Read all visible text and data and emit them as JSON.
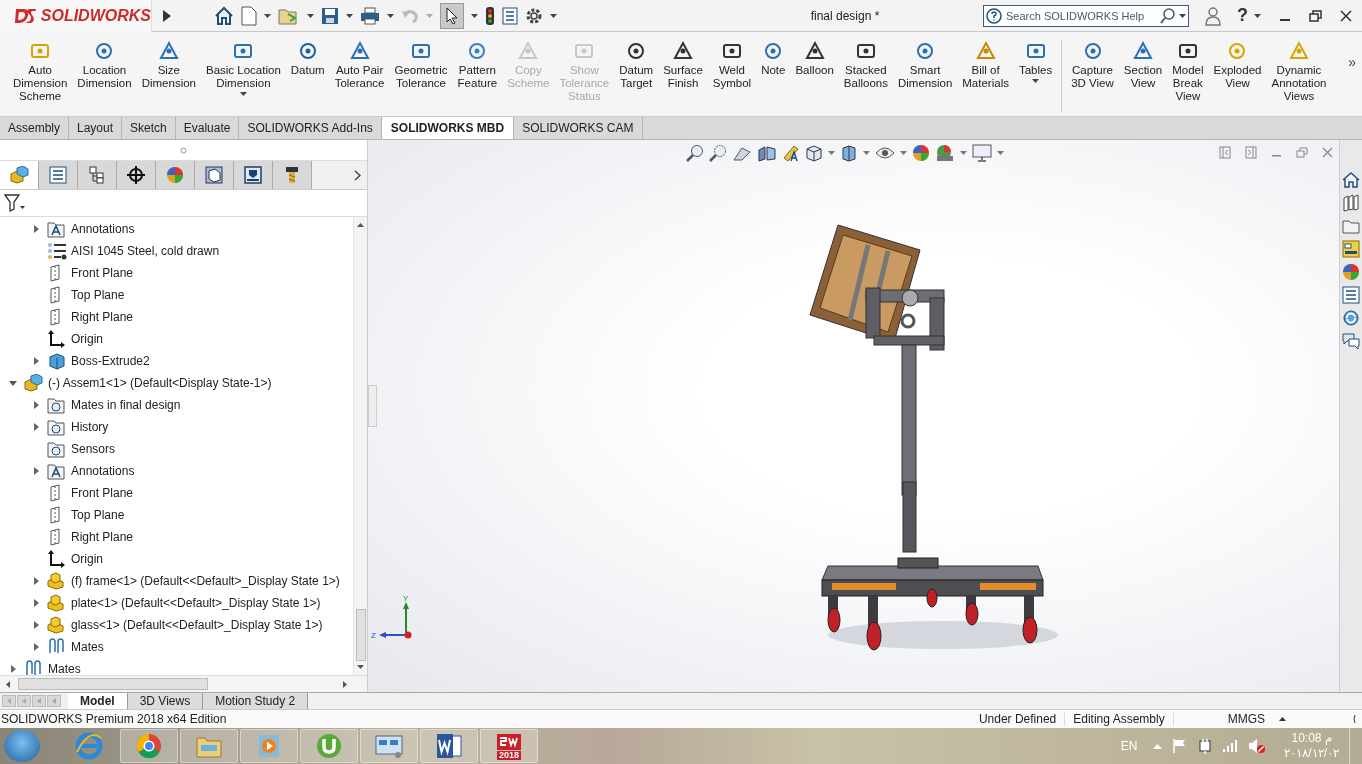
{
  "app": {
    "logo": "SOLIDWORKS",
    "title": "final design *",
    "search": {
      "placeholder": "Search SOLIDWORKS Help"
    },
    "help": "?"
  },
  "ribbon": {
    "commands": [
      {
        "label": "Auto\nDimension\nScheme",
        "disabled": false,
        "dropdown": false,
        "separator_before": false
      },
      {
        "label": "Location\nDimension",
        "disabled": false,
        "dropdown": false,
        "separator_before": false
      },
      {
        "label": "Size\nDimension",
        "disabled": false,
        "dropdown": false,
        "separator_before": false
      },
      {
        "label": "Basic Location\nDimension",
        "disabled": false,
        "dropdown": true,
        "separator_before": false
      },
      {
        "label": "Datum",
        "disabled": false,
        "dropdown": false,
        "separator_before": false
      },
      {
        "label": "Auto Pair\nTolerance",
        "disabled": false,
        "dropdown": false,
        "separator_before": false
      },
      {
        "label": "Geometric\nTolerance",
        "disabled": false,
        "dropdown": false,
        "separator_before": false
      },
      {
        "label": "Pattern\nFeature",
        "disabled": false,
        "dropdown": false,
        "separator_before": false
      },
      {
        "label": "Copy\nScheme",
        "disabled": true,
        "dropdown": false,
        "separator_before": false
      },
      {
        "label": "Show\nTolerance\nStatus",
        "disabled": true,
        "dropdown": false,
        "separator_before": false
      },
      {
        "label": "Datum\nTarget",
        "disabled": false,
        "dropdown": false,
        "separator_before": false
      },
      {
        "label": "Surface\nFinish",
        "disabled": false,
        "dropdown": false,
        "separator_before": false
      },
      {
        "label": "Weld\nSymbol",
        "disabled": false,
        "dropdown": false,
        "separator_before": false
      },
      {
        "label": "Note",
        "disabled": false,
        "dropdown": false,
        "separator_before": false
      },
      {
        "label": "Balloon",
        "disabled": false,
        "dropdown": false,
        "separator_before": false
      },
      {
        "label": "Stacked\nBalloons",
        "disabled": false,
        "dropdown": false,
        "separator_before": false
      },
      {
        "label": "Smart\nDimension",
        "disabled": false,
        "dropdown": false,
        "separator_before": false
      },
      {
        "label": "Bill of\nMaterials",
        "disabled": false,
        "dropdown": false,
        "separator_before": false
      },
      {
        "label": "Tables",
        "disabled": false,
        "dropdown": true,
        "separator_before": false
      },
      {
        "label": "Capture\n3D View",
        "disabled": false,
        "dropdown": false,
        "separator_before": true
      },
      {
        "label": "Section\nView",
        "disabled": false,
        "dropdown": false,
        "separator_before": false
      },
      {
        "label": "Model\nBreak\nView",
        "disabled": false,
        "dropdown": false,
        "separator_before": false
      },
      {
        "label": "Exploded\nView",
        "disabled": false,
        "dropdown": false,
        "separator_before": false
      },
      {
        "label": "Dynamic\nAnnotation\nViews",
        "disabled": false,
        "dropdown": false,
        "separator_before": false
      }
    ],
    "overflow": "»"
  },
  "command_tabs": [
    {
      "label": "Assembly",
      "selected": false
    },
    {
      "label": "Layout",
      "selected": false
    },
    {
      "label": "Sketch",
      "selected": false
    },
    {
      "label": "Evaluate",
      "selected": false
    },
    {
      "label": "SOLIDWORKS Add-Ins",
      "selected": false
    },
    {
      "label": "SOLIDWORKS MBD",
      "selected": true
    },
    {
      "label": "SOLIDWORKS CAM",
      "selected": false
    }
  ],
  "manager_tabs": [
    {
      "selected": true
    },
    {
      "selected": false
    },
    {
      "selected": false
    },
    {
      "selected": false
    },
    {
      "selected": false
    },
    {
      "selected": false
    },
    {
      "selected": false
    },
    {
      "selected": false
    }
  ],
  "tree": {
    "partial_items": [
      {
        "label": "Annotations",
        "kind": "annotations",
        "expanded": false
      },
      {
        "label": "AISI 1045 Steel, cold drawn",
        "kind": "material"
      },
      {
        "label": "Front Plane",
        "kind": "plane"
      },
      {
        "label": "Top Plane",
        "kind": "plane"
      },
      {
        "label": "Right Plane",
        "kind": "plane"
      },
      {
        "label": "Origin",
        "kind": "origin"
      },
      {
        "label": "Boss-Extrude2",
        "kind": "body",
        "expanded": false
      }
    ],
    "items": [
      {
        "label": "(-) Assem1<1> (Default<Display State-1>)",
        "kind": "assembly",
        "expanded": true,
        "children": [
          {
            "label": "Mates in final design",
            "kind": "mates-folder",
            "expanded": false
          },
          {
            "label": "History",
            "kind": "history",
            "expanded": false
          },
          {
            "label": "Sensors",
            "kind": "sensors"
          },
          {
            "label": "Annotations",
            "kind": "annotations",
            "expanded": false
          },
          {
            "label": "Front Plane",
            "kind": "plane"
          },
          {
            "label": "Top Plane",
            "kind": "plane"
          },
          {
            "label": "Right Plane",
            "kind": "plane"
          },
          {
            "label": "Origin",
            "kind": "origin"
          },
          {
            "label": "(f) frame<1> (Default<<Default>_Display State 1>)",
            "kind": "part",
            "expanded": false
          },
          {
            "label": "plate<1> (Default<<Default>_Display State 1>)",
            "kind": "part",
            "expanded": false
          },
          {
            "label": "glass<1> (Default<<Default>_Display State 1>)",
            "kind": "part",
            "expanded": false
          },
          {
            "label": "Mates",
            "kind": "mates",
            "expanded": false
          }
        ]
      },
      {
        "label": "Mates",
        "kind": "mates",
        "expanded": false
      }
    ]
  },
  "viewport": {
    "triad": {
      "y": "Y",
      "z": "Z"
    }
  },
  "bottom_tabs": [
    {
      "label": "Model",
      "selected": true
    },
    {
      "label": "3D Views",
      "selected": false
    },
    {
      "label": "Motion Study 2",
      "selected": false
    }
  ],
  "status_bar": {
    "edition": "SOLIDWORKS Premium 2018 x64 Edition",
    "state": "Under Defined",
    "mode": "Editing Assembly",
    "units": "MMGS"
  },
  "taskbar": {
    "app_badge": "2018",
    "language": "EN",
    "time": "10:08 م",
    "date": "٢٠١٨/١٢/٠٢"
  }
}
